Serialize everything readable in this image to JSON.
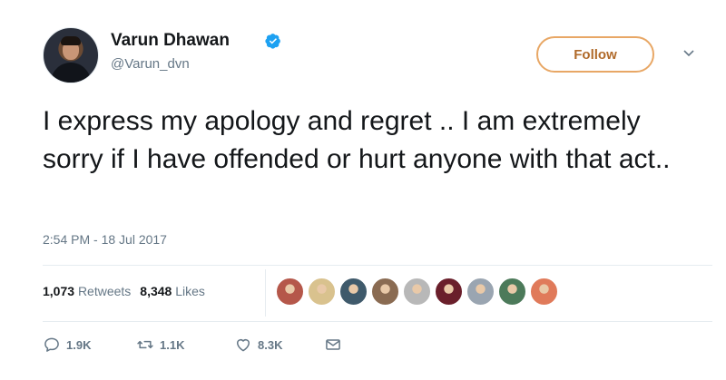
{
  "user": {
    "display_name": "Varun Dhawan",
    "handle": "@Varun_dvn",
    "verified": true,
    "avatar_icon": "profile-photo"
  },
  "follow_button": {
    "label": "Follow"
  },
  "tweet": {
    "text": "I express my apology and regret .. I am extremely sorry if I have offended or hurt anyone with that act..",
    "timestamp": "2:54 PM - 18 Jul 2017"
  },
  "stats": {
    "retweets_count": "1,073",
    "retweets_label": "Retweets",
    "likes_count": "8,348",
    "likes_label": "Likes"
  },
  "liker_avatars": [
    {
      "color": "#b5574a"
    },
    {
      "color": "#d9c28e"
    },
    {
      "color": "#3f5a6b"
    },
    {
      "color": "#8a6b52"
    },
    {
      "color": "#b8b8b8"
    },
    {
      "color": "#6a1f2b"
    },
    {
      "color": "#9aa5b1"
    },
    {
      "color": "#4c7a5a"
    },
    {
      "color": "#e07a5a"
    }
  ],
  "actions": {
    "reply_count": "1.9K",
    "retweet_count": "1.1K",
    "like_count": "8.3K",
    "reply_icon": "reply-icon",
    "retweet_icon": "retweet-icon",
    "like_icon": "heart-icon",
    "dm_icon": "envelope-icon"
  },
  "colors": {
    "follow_accent": "#e8a765",
    "verified_blue": "#1da1f2",
    "secondary_text": "#657786"
  }
}
